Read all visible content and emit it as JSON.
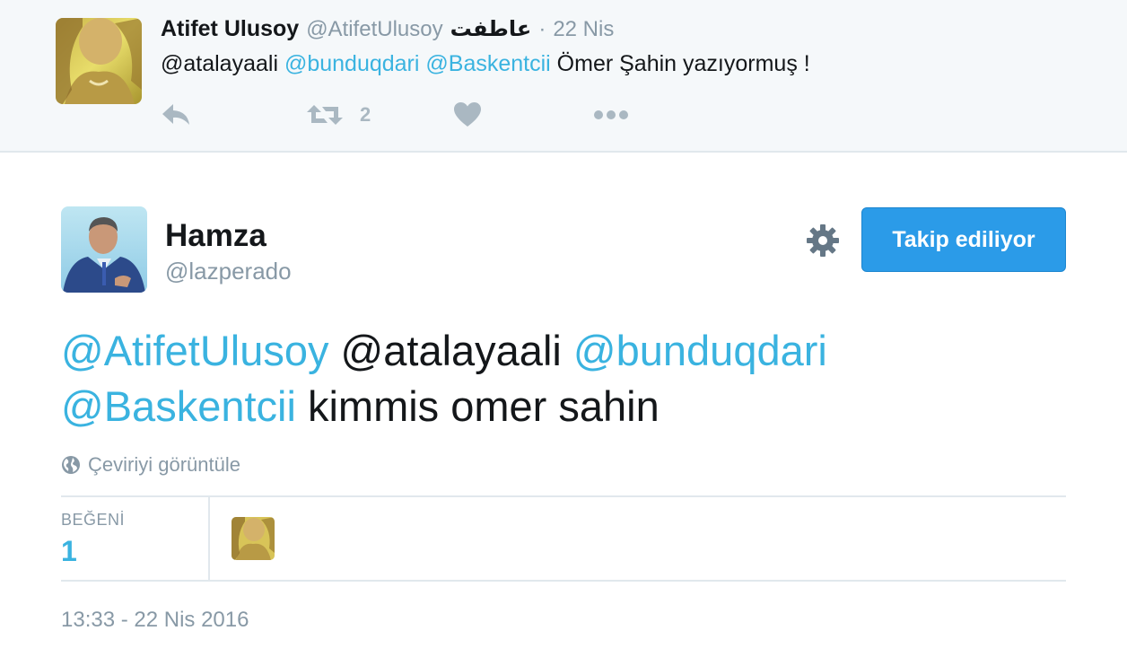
{
  "parent_tweet": {
    "name": "Atifet Ulusoy",
    "handle": "@AtifetUlusoy",
    "display_suffix": "عاطفت",
    "separator": "·",
    "date": "22 Nis",
    "text_parts": [
      {
        "text": "@atalayaali ",
        "mention": false
      },
      {
        "text": "@bunduqdari",
        "mention": true
      },
      {
        "text": " ",
        "mention": false
      },
      {
        "text": "@Baskentcii",
        "mention": true
      },
      {
        "text": " Ömer Şahin yazıyormuş !",
        "mention": false
      }
    ],
    "actions": {
      "reply_icon": "reply-icon",
      "retweet_icon": "retweet-icon",
      "retweet_count": "2",
      "like_icon": "heart-icon",
      "more_icon": "more-dots-icon"
    }
  },
  "main_tweet": {
    "name": "Hamza",
    "handle": "@lazperado",
    "settings_icon": "gear-icon",
    "follow_button_label": "Takip ediliyor",
    "text_parts": [
      {
        "text": "@AtifetUlusoy",
        "mention": true
      },
      {
        "text": " @atalayaali ",
        "mention": false
      },
      {
        "text": "@bunduqdari",
        "mention": true
      },
      {
        "text": " ",
        "mention": false
      },
      {
        "text": "@Baskentcii",
        "mention": true
      },
      {
        "text": " kimmis omer sahin",
        "mention": false
      }
    ],
    "translate_icon": "globe-icon",
    "translate_label": "Çeviriyi görüntüle",
    "stats": {
      "likes_label": "BEĞENİ",
      "likes_count": "1"
    },
    "timestamp": "13:33 - 22 Nis 2016"
  },
  "colors": {
    "mention": "#3ab3e0",
    "follow_button": "#2b9be8",
    "muted": "#8899a6",
    "parent_bg": "#f5f8fa"
  }
}
